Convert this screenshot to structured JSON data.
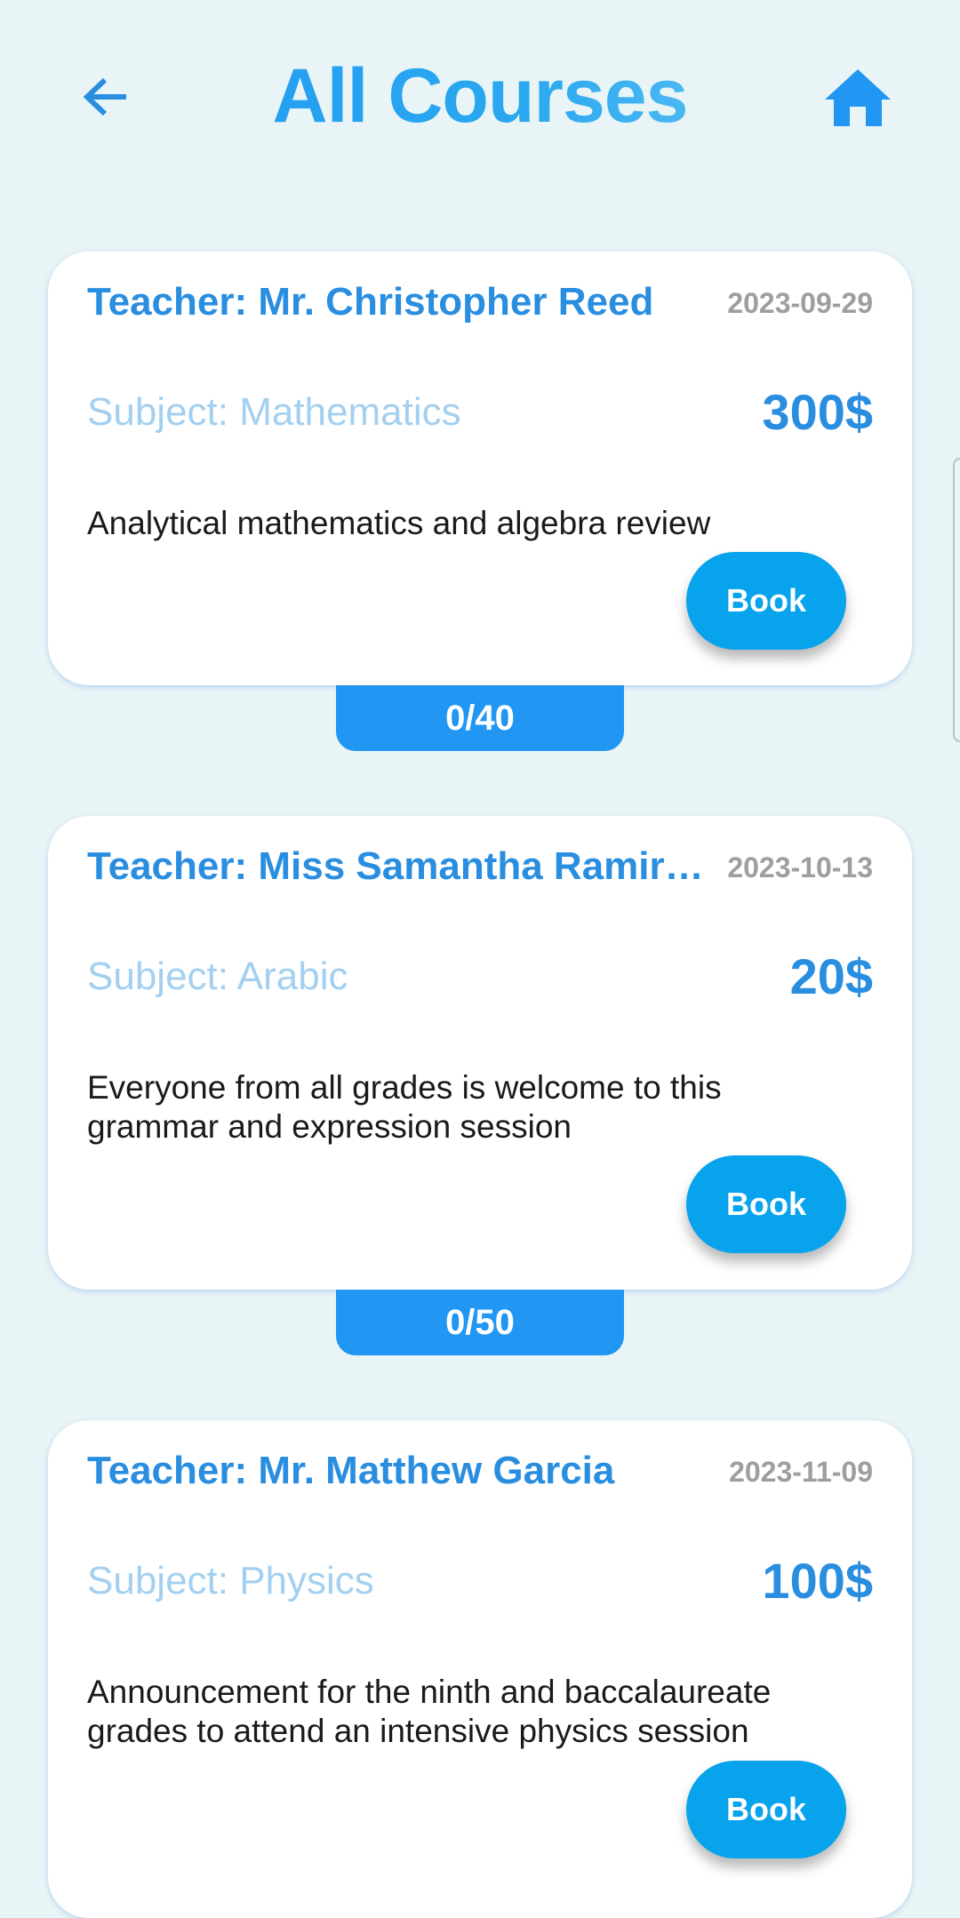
{
  "header": {
    "title": "All Courses",
    "back_icon": "arrow-back-icon",
    "home_icon": "home-icon"
  },
  "colors": {
    "background": "#e8f4f5",
    "accent": "#2196f3",
    "button": "#07a3ec",
    "teacher_text": "#2a8ee0",
    "subject_text": "#a3d0f0",
    "date_text": "#9e9e9e"
  },
  "courses": [
    {
      "teacher": "Teacher: Mr. Christopher Reed",
      "date": "2023-09-29",
      "subject": "Subject: Mathematics",
      "price": "300$",
      "description": "Analytical mathematics and algebra review",
      "book_label": "Book",
      "capacity": "0/40"
    },
    {
      "teacher": "Teacher: Miss Samantha Ramir…",
      "date": "2023-10-13",
      "subject": "Subject: Arabic",
      "price": "20$",
      "description": "Everyone from all grades is welcome to this grammar and expression session",
      "book_label": "Book",
      "capacity": "0/50"
    },
    {
      "teacher": "Teacher: Mr. Matthew Garcia",
      "date": "2023-11-09",
      "subject": "Subject: Physics",
      "price": "100$",
      "description": "Announcement for the ninth and baccalaureate grades to attend an intensive physics session",
      "book_label": "Book"
    }
  ]
}
